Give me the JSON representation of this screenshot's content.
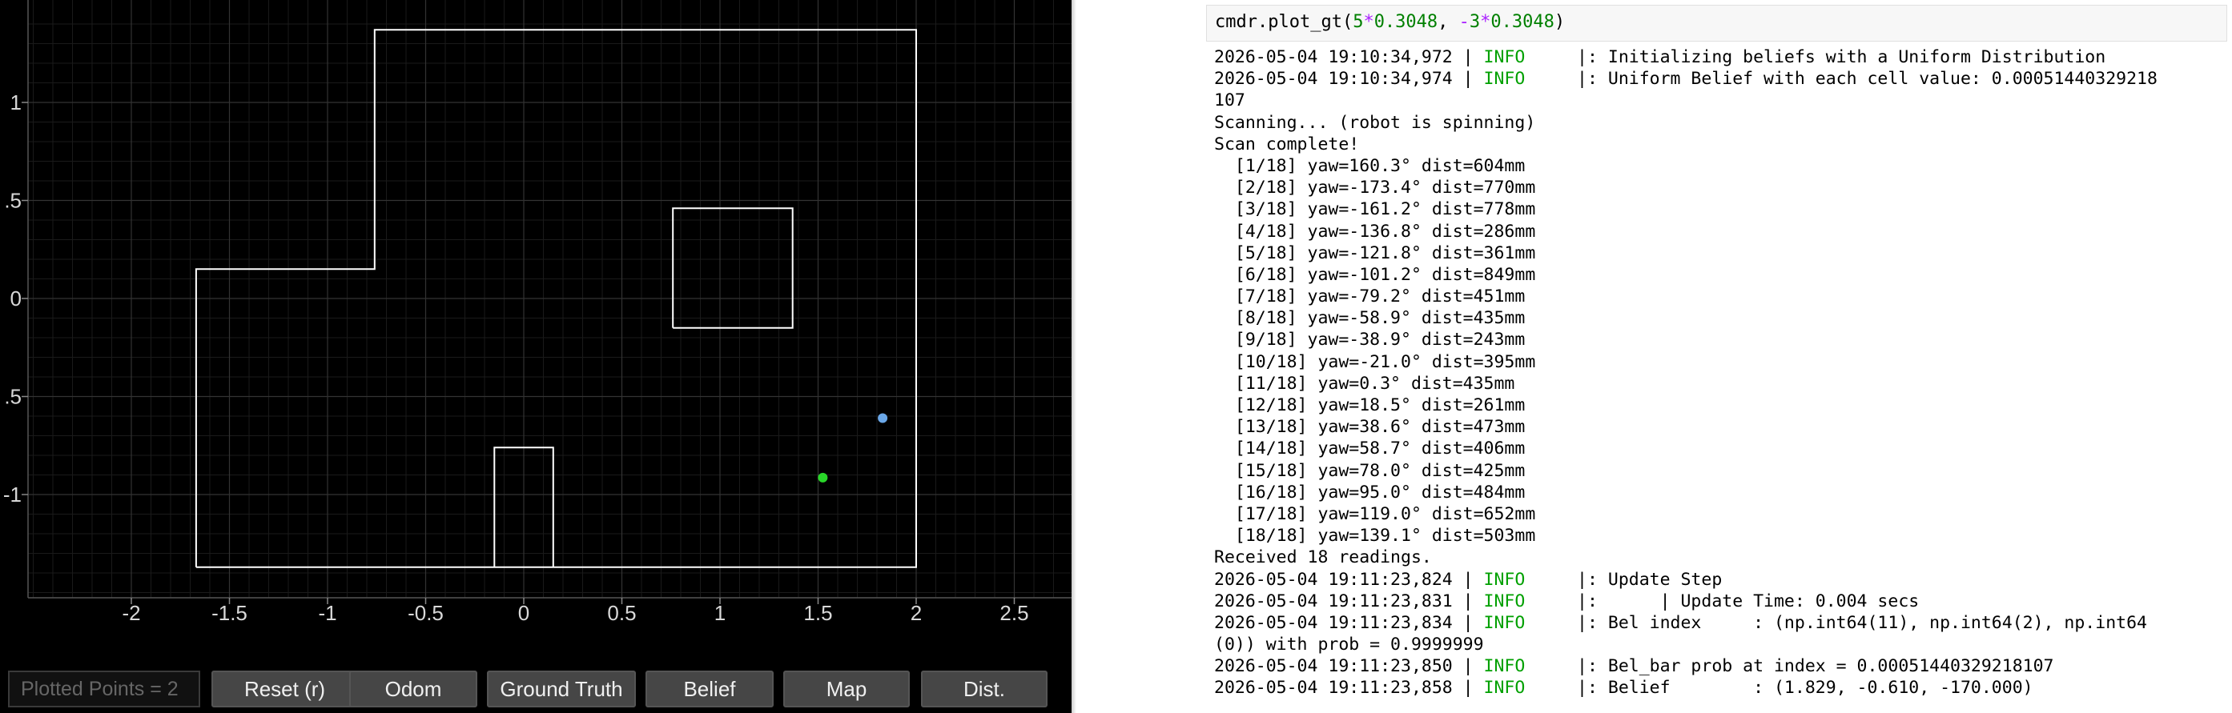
{
  "plot": {
    "x_ticks": [
      "-2",
      "-1.5",
      "-1",
      "-0.5",
      "0",
      "0.5",
      "1",
      "1.5",
      "2",
      "2.5"
    ],
    "y_ticks": [
      "1",
      ".5",
      "0",
      ".5",
      "-1"
    ],
    "x_tick_values": [
      -2,
      -1.5,
      -1,
      -0.5,
      0,
      0.5,
      1,
      1.5,
      2,
      2.5
    ],
    "y_tick_values": [
      1,
      0.5,
      0,
      -0.5,
      -1
    ],
    "x_range": [
      -2.5,
      2.8
    ],
    "y_range": [
      -1.6,
      1.4
    ],
    "map_color": "#ffffff",
    "background": "#000000",
    "walls": [
      [
        [
          -1.67,
          -1.37
        ],
        [
          -1.67,
          0.15
        ],
        [
          -0.76,
          0.15
        ],
        [
          -0.76,
          1.37
        ],
        [
          2.0,
          1.37
        ],
        [
          2.0,
          -1.37
        ],
        [
          -1.67,
          -1.37
        ]
      ],
      [
        [
          0.76,
          -0.15
        ],
        [
          1.37,
          -0.15
        ],
        [
          1.37,
          0.46
        ],
        [
          0.76,
          0.46
        ],
        [
          0.76,
          -0.15
        ]
      ],
      [
        [
          -0.15,
          -1.37
        ],
        [
          -0.15,
          -0.76
        ],
        [
          0.15,
          -0.76
        ],
        [
          0.15,
          -1.37
        ]
      ]
    ],
    "points": [
      {
        "name": "belief-point",
        "x": 1.829,
        "y": -0.61,
        "color": "#6aa7e8"
      },
      {
        "name": "ground-truth-point",
        "x": 1.524,
        "y": -0.914,
        "color": "#29d629"
      }
    ]
  },
  "toolbar": {
    "counter": "Plotted Points = 2",
    "buttons": [
      "Reset (r)",
      "Odom",
      "Ground Truth",
      "Belief",
      "Map",
      "Dist."
    ]
  },
  "notebook": {
    "cell_code": {
      "prefix": "cmdr.plot_gt(",
      "a": "5",
      "mul1": "*",
      "b": "0.3048",
      "sep": ", ",
      "neg": "-",
      "c": "3",
      "mul2": "*",
      "d": "0.3048",
      "suffix": ")"
    },
    "output_lines": [
      {
        "ts": "2026-05-04 19:10:34,972 | ",
        "level": "INFO",
        "msg": "     |: Initializing beliefs with a Uniform Distribution"
      },
      {
        "ts": "2026-05-04 19:10:34,974 | ",
        "level": "INFO",
        "msg": "     |: Uniform Belief with each cell value: 0.00051440329218"
      },
      {
        "text": "107"
      },
      {
        "text": "Scanning... (robot is spinning)"
      },
      {
        "text": "Scan complete!"
      },
      {
        "text": "  [1/18] yaw=160.3° dist=604mm"
      },
      {
        "text": "  [2/18] yaw=-173.4° dist=770mm"
      },
      {
        "text": "  [3/18] yaw=-161.2° dist=778mm"
      },
      {
        "text": "  [4/18] yaw=-136.8° dist=286mm"
      },
      {
        "text": "  [5/18] yaw=-121.8° dist=361mm"
      },
      {
        "text": "  [6/18] yaw=-101.2° dist=849mm"
      },
      {
        "text": "  [7/18] yaw=-79.2° dist=451mm"
      },
      {
        "text": "  [8/18] yaw=-58.9° dist=435mm"
      },
      {
        "text": "  [9/18] yaw=-38.9° dist=243mm"
      },
      {
        "text": "  [10/18] yaw=-21.0° dist=395mm"
      },
      {
        "text": "  [11/18] yaw=0.3° dist=435mm"
      },
      {
        "text": "  [12/18] yaw=18.5° dist=261mm"
      },
      {
        "text": "  [13/18] yaw=38.6° dist=473mm"
      },
      {
        "text": "  [14/18] yaw=58.7° dist=406mm"
      },
      {
        "text": "  [15/18] yaw=78.0° dist=425mm"
      },
      {
        "text": "  [16/18] yaw=95.0° dist=484mm"
      },
      {
        "text": "  [17/18] yaw=119.0° dist=652mm"
      },
      {
        "text": "  [18/18] yaw=139.1° dist=503mm"
      },
      {
        "text": "Received 18 readings."
      },
      {
        "ts": "2026-05-04 19:11:23,824 | ",
        "level": "INFO",
        "msg": "     |: Update Step"
      },
      {
        "ts": "2026-05-04 19:11:23,831 | ",
        "level": "INFO",
        "msg": "     |:      | Update Time: 0.004 secs"
      },
      {
        "ts": "2026-05-04 19:11:23,834 | ",
        "level": "INFO",
        "msg": "     |: Bel index     : (np.int64(11), np.int64(2), np.int64"
      },
      {
        "text": "(0)) with prob = 0.9999999"
      },
      {
        "ts": "2026-05-04 19:11:23,850 | ",
        "level": "INFO",
        "msg": "     |: Bel_bar prob at index = 0.00051440329218107"
      },
      {
        "ts": "2026-05-04 19:11:23,858 | ",
        "level": "INFO",
        "msg": "     |: Belief        : (1.829, -0.610, -170.000)"
      }
    ]
  }
}
